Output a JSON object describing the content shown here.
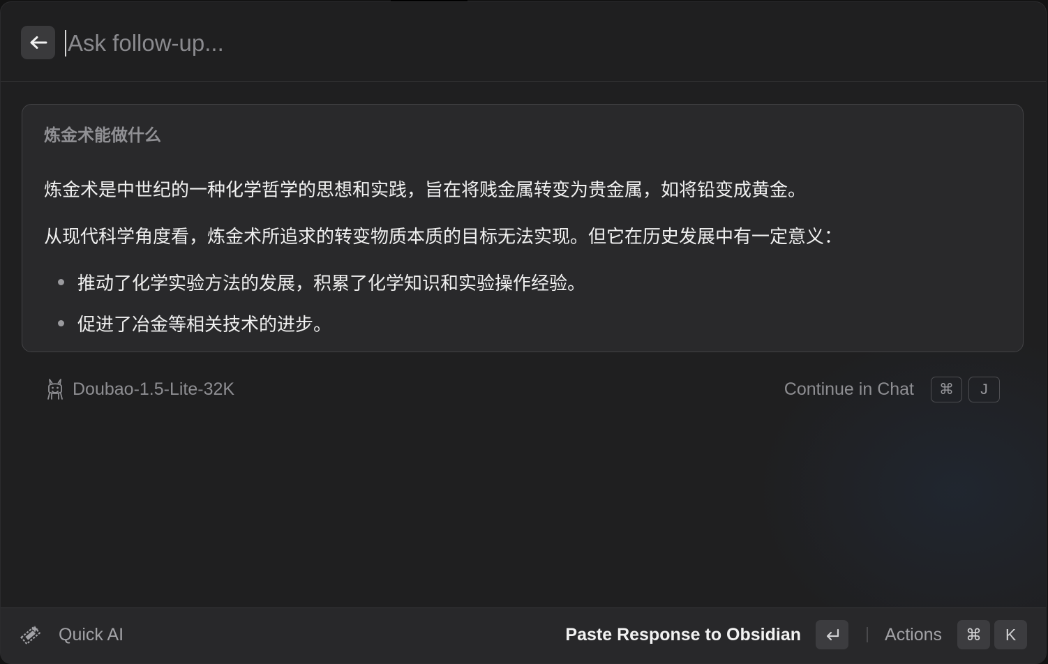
{
  "header": {
    "back_icon": "arrow-left-icon",
    "search_placeholder": "Ask follow-up..."
  },
  "response": {
    "question": "炼金术能做什么",
    "paragraphs": [
      "炼金术是中世纪的一种化学哲学的思想和实践，旨在将贱金属转变为贵金属，如将铅变成黄金。",
      "从现代科学角度看，炼金术所追求的转变物质本质的目标无法实现。但它在历史发展中有一定意义："
    ],
    "bullets": [
      "推动了化学实验方法的发展，积累了化学知识和实验操作经验。",
      "促进了冶金等相关技术的进步。"
    ]
  },
  "model": {
    "icon": "llama-icon",
    "name": "Doubao-1.5-Lite-32K"
  },
  "continue_chat": {
    "label": "Continue in Chat",
    "keys": [
      "⌘",
      "J"
    ]
  },
  "footer": {
    "app_icon": "quick-ai-icon",
    "title": "Quick AI",
    "primary_action": "Paste Response to Obsidian",
    "primary_key": "↵",
    "actions_label": "Actions",
    "actions_keys": [
      "⌘",
      "K"
    ]
  },
  "colors": {
    "window_bg": "#1f1f20",
    "card_bg": "#29292b",
    "footer_bg": "#28282a",
    "text_primary": "#f0f0f0",
    "text_muted": "#8e8e92"
  }
}
